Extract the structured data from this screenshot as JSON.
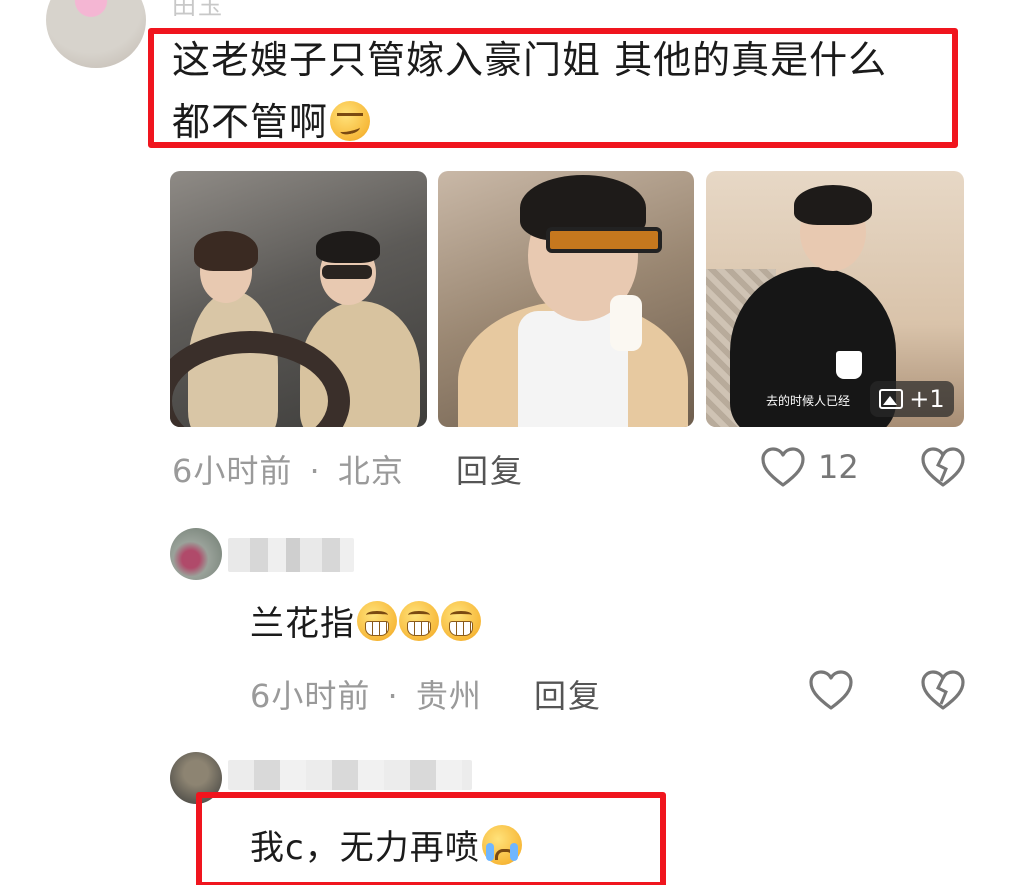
{
  "comments": [
    {
      "username": "田玉",
      "text": "这老嫂子只管嫁入豪门姐 其他的真是什么都不管啊",
      "line1": "这老嫂子只管嫁入豪门姐 其他的真是什么",
      "line2": "都不管啊",
      "time": "6小时前",
      "location": "北京",
      "reply_label": "回复",
      "likes": "12",
      "photo_caption": "去的时候人已经",
      "more_photos": "+1"
    },
    {
      "text": "兰花指",
      "time": "6小时前",
      "location": "贵州",
      "reply_label": "回复"
    },
    {
      "text": "我c，无力再喷"
    }
  ],
  "separator": "·",
  "colors": {
    "highlight": "#f0151e",
    "meta": "#9a9a9a"
  }
}
